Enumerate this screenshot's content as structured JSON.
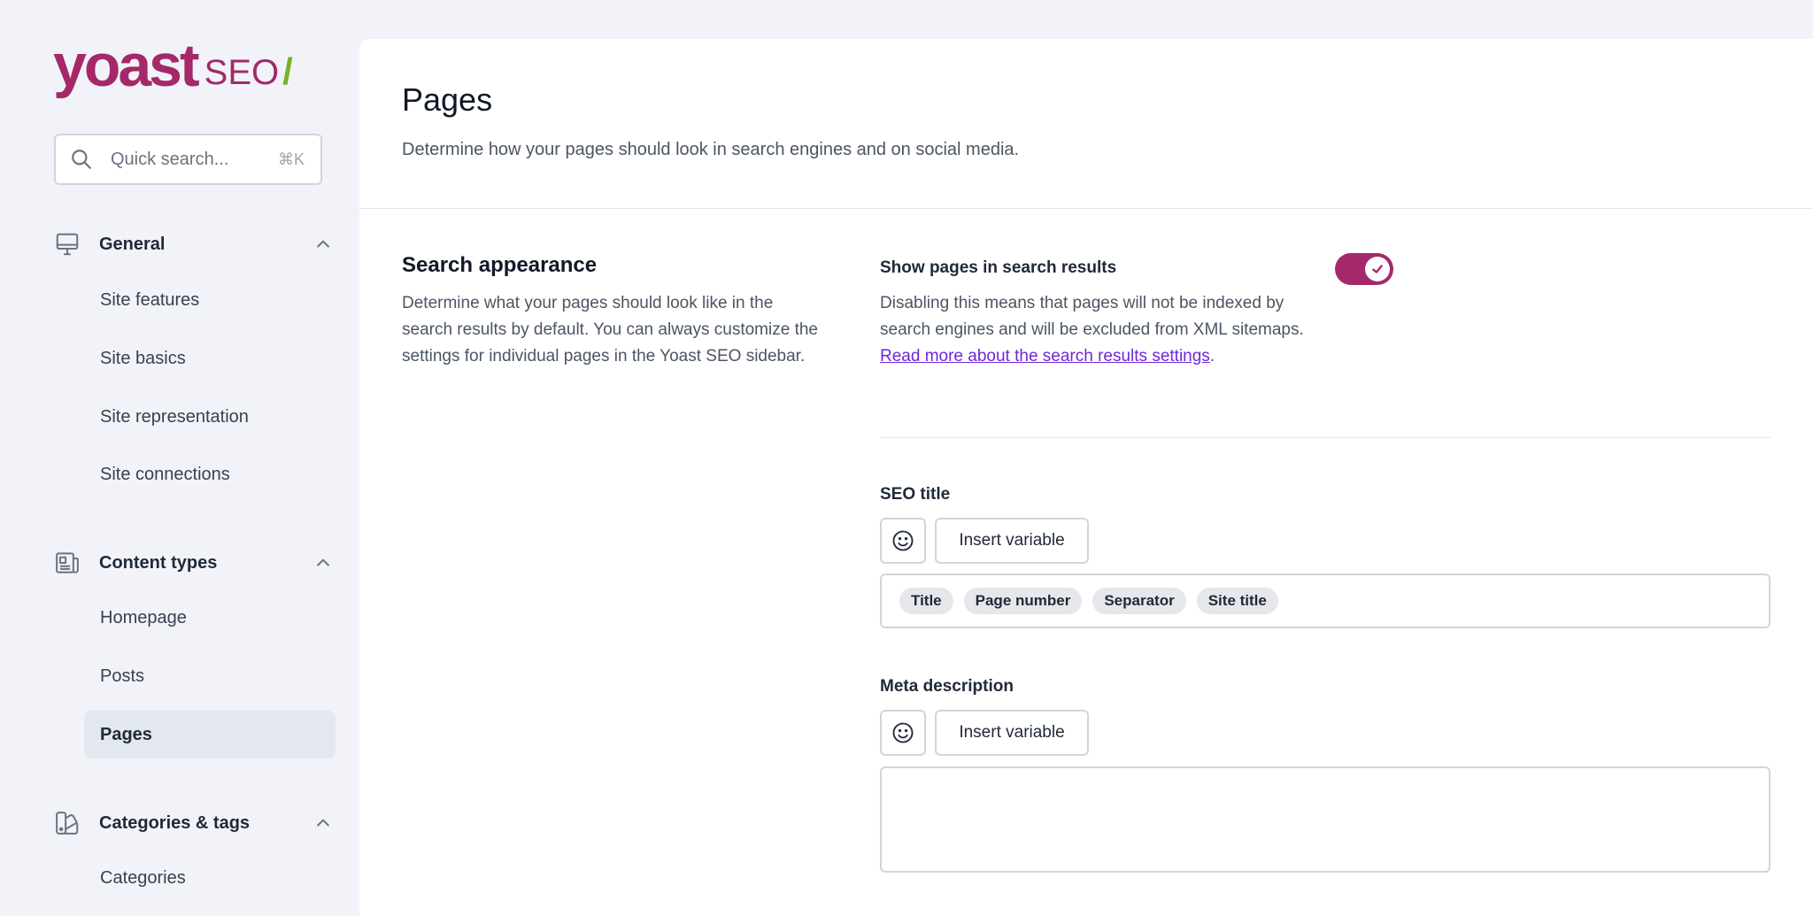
{
  "logo": {
    "wordmark": "yoast",
    "product": "SEO",
    "slash": "/"
  },
  "search": {
    "placeholder": "Quick search...",
    "shortcut": "⌘K",
    "icon": "search-icon"
  },
  "nav": {
    "groups": [
      {
        "label": "General",
        "icon": "desktop-icon",
        "expanded": true,
        "items": [
          "Site features",
          "Site basics",
          "Site representation",
          "Site connections"
        ]
      },
      {
        "label": "Content types",
        "icon": "newspaper-icon",
        "expanded": true,
        "items": [
          "Homepage",
          "Posts",
          "Pages"
        ]
      },
      {
        "label": "Categories & tags",
        "icon": "color-swatch-icon",
        "expanded": true,
        "items": [
          "Categories"
        ]
      }
    ],
    "active_item": "Pages"
  },
  "page": {
    "title": "Pages",
    "description": "Determine how your pages should look in search engines and on social media."
  },
  "search_appearance": {
    "title": "Search appearance",
    "description": "Determine what your pages should look like in the search results by default. You can always customize the settings for individual pages in the Yoast SEO sidebar.",
    "toggle": {
      "label": "Show pages in search results",
      "checked": true,
      "desc_text": "Disabling this means that pages will not be indexed by search engines and will be excluded from XML sitemaps. ",
      "link_text": "Read more about the search results settings",
      "desc_end": "."
    },
    "seo_title": {
      "label": "SEO title",
      "insert_variable_label": "Insert variable",
      "variables": [
        "Title",
        "Page number",
        "Separator",
        "Site title"
      ]
    },
    "meta_description": {
      "label": "Meta description",
      "insert_variable_label": "Insert variable",
      "value": ""
    }
  },
  "colors": {
    "brand": "#a4286a",
    "link": "#6d28d9",
    "logo_slash": "#77b227"
  }
}
